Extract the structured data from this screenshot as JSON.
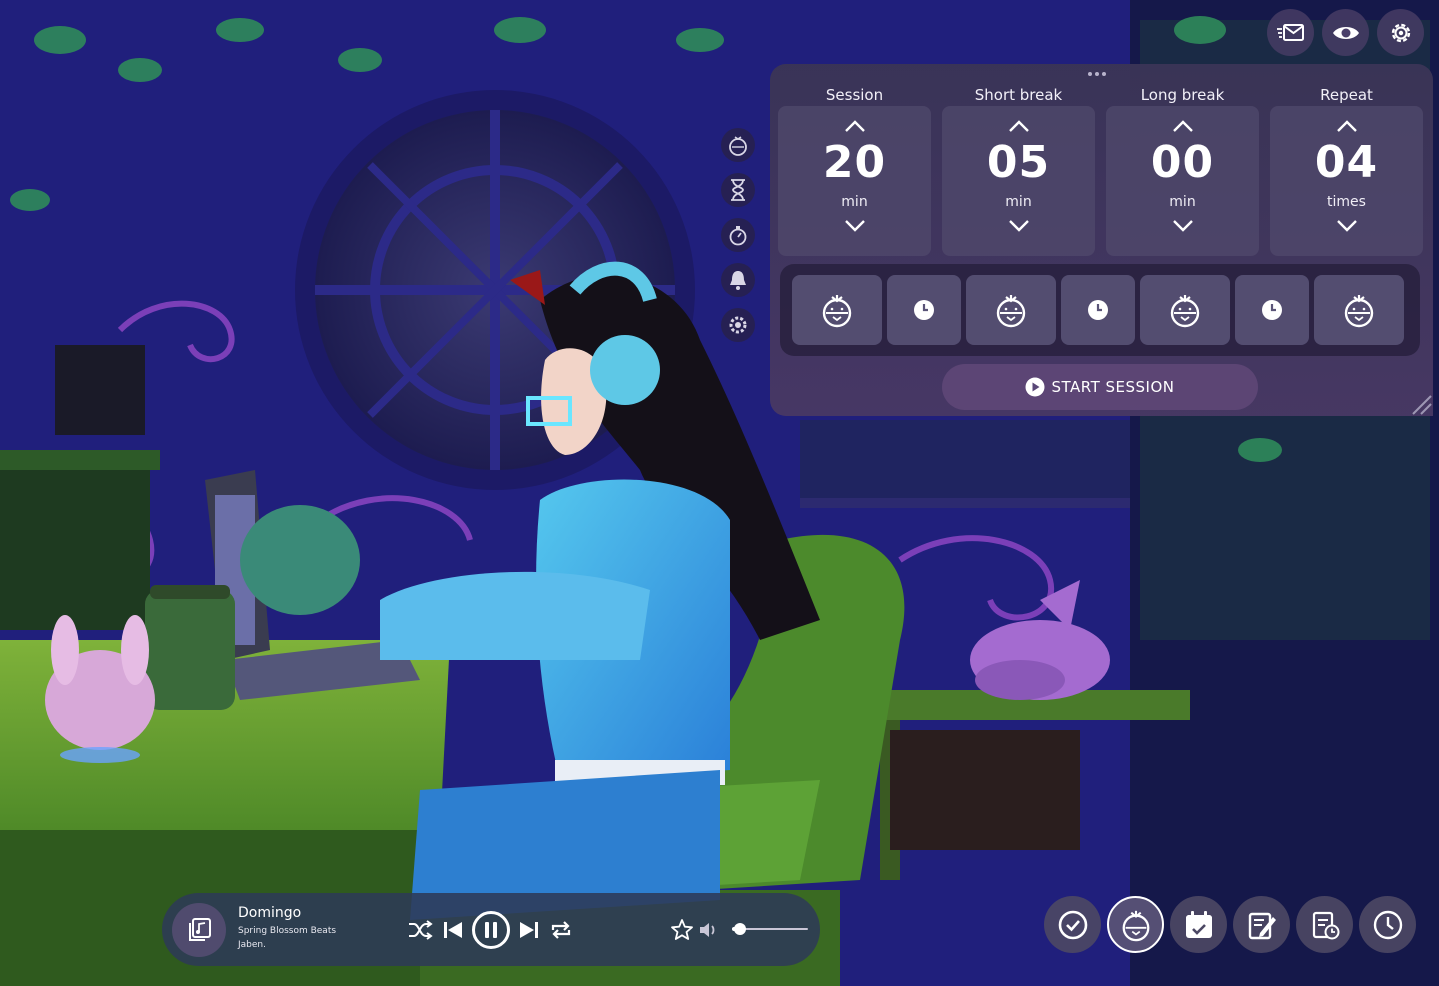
{
  "timer": {
    "columns": [
      {
        "label": "Session",
        "value": "20",
        "unit": "min"
      },
      {
        "label": "Short break",
        "value": "05",
        "unit": "min"
      },
      {
        "label": "Long break",
        "value": "00",
        "unit": "min"
      },
      {
        "label": "Repeat",
        "value": "04",
        "unit": "times"
      }
    ],
    "sequence": [
      "session",
      "break",
      "session",
      "break",
      "session",
      "break",
      "session"
    ],
    "start_label": "START SESSION"
  },
  "top_icons": [
    "mail-icon",
    "eye-icon",
    "gear-icon"
  ],
  "side_rail": [
    "tomato-icon",
    "hourglass-icon",
    "stopwatch-icon",
    "bell-icon",
    "gear-icon"
  ],
  "player": {
    "title": "Domingo",
    "album": "Spring Blossom Beats",
    "artist": "Jaben.",
    "volume": 0.1
  },
  "dock": [
    "check-icon",
    "tomato-icon",
    "calendar-icon",
    "notes-icon",
    "clipboard-icon",
    "clock-icon"
  ],
  "colors": {
    "background": "#1e1c6e",
    "panel": "#3a3456",
    "accent": "#ffffff"
  }
}
